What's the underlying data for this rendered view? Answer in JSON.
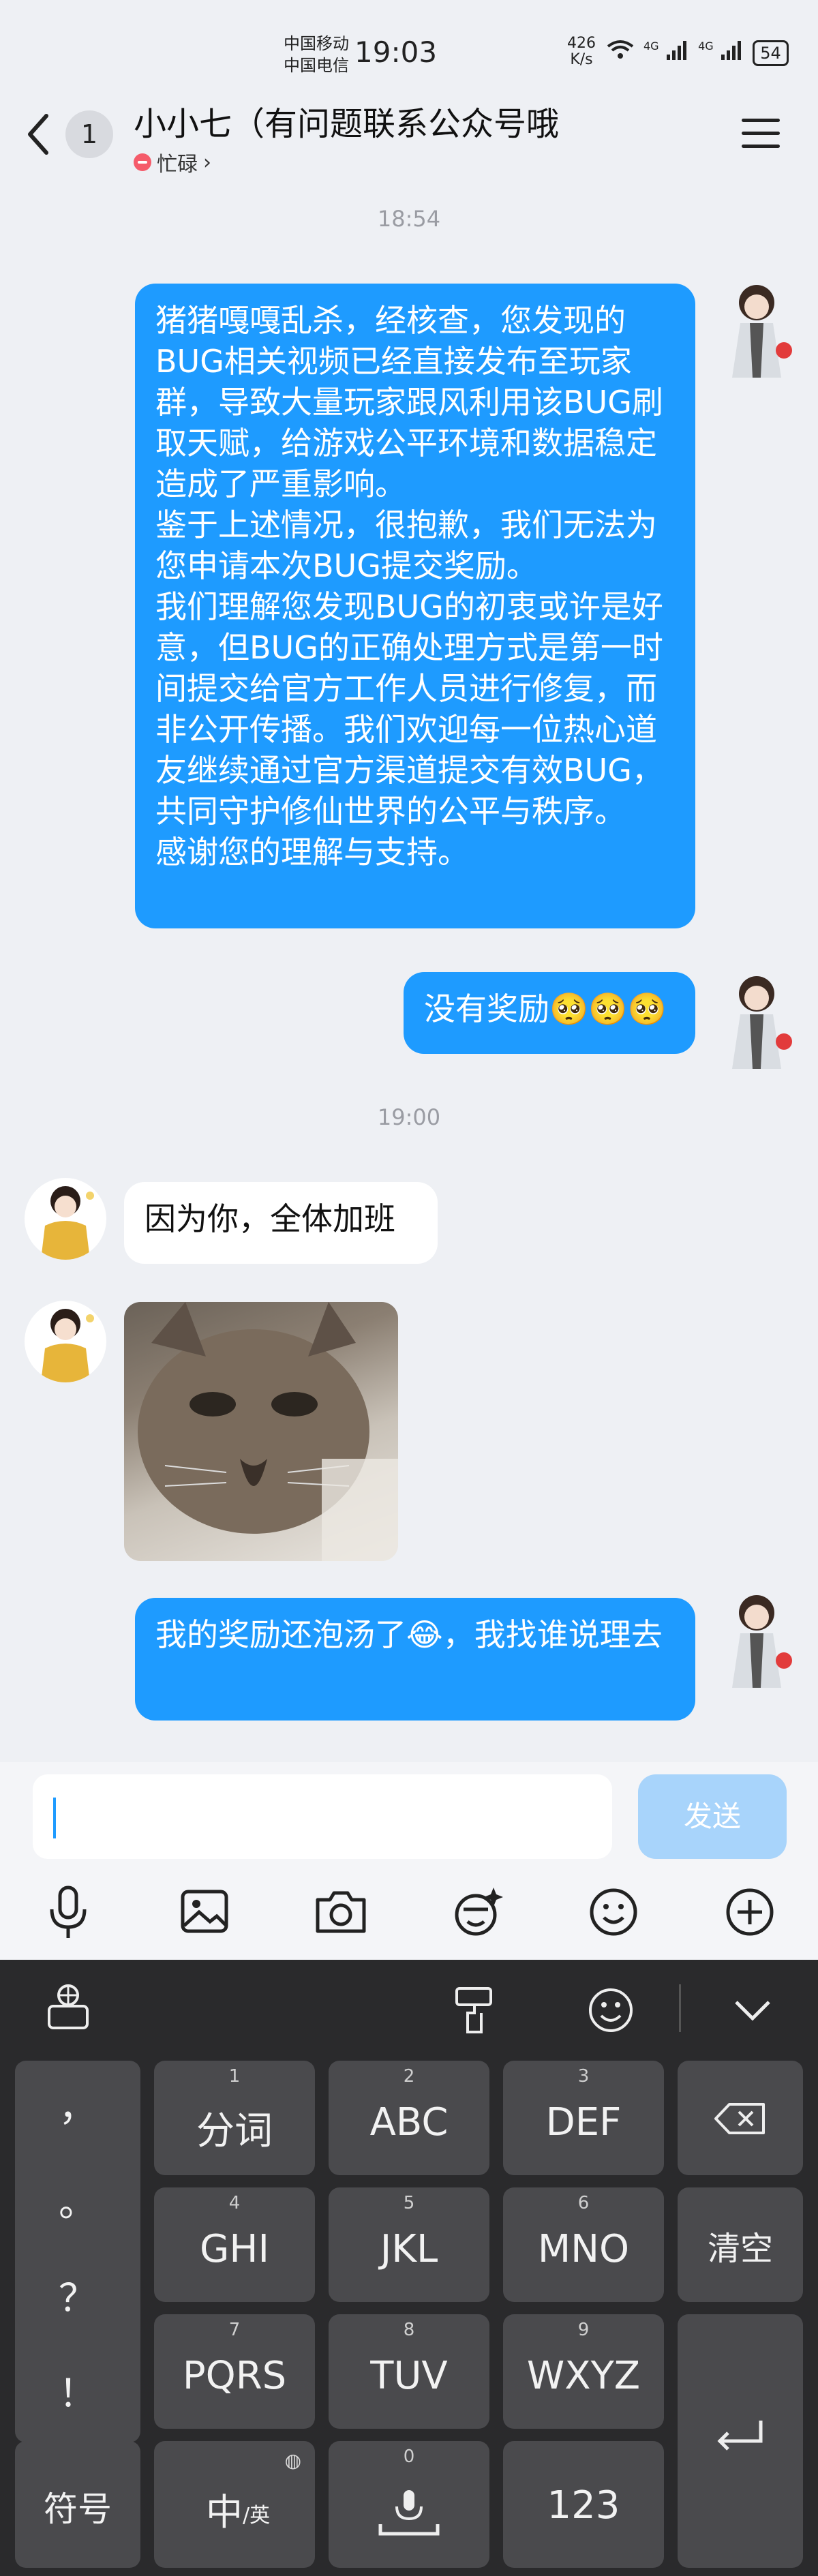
{
  "status_bar": {
    "carrier_1": "中国移动",
    "carrier_2": "中国电信",
    "time": "19:03",
    "speed_value": "426",
    "speed_unit": "K/s",
    "network_1": "4G",
    "network_2": "4G",
    "battery": "54"
  },
  "header": {
    "unread_count": "1",
    "title": "小小七（有问题联系公众号哦",
    "status": "忙碌"
  },
  "chat": {
    "timestamps": [
      "18:54",
      "19:00"
    ],
    "messages": [
      {
        "side": "me",
        "text": "猪猪嘎嘎乱杀，经核查，您发现的BUG相关视频已经直接发布至玩家群，导致大量玩家跟风利用该BUG刷取天赋，给游戏公平环境和数据稳定造成了严重影响。\n鉴于上述情况，很抱歉，我们无法为您申请本次BUG提交奖励。\n我们理解您发现BUG的初衷或许是好意，但BUG的正确处理方式是第一时间提交给官方工作人员进行修复，而非公开传播。我们欢迎每一位热心道友继续通过官方渠道提交有效BUG，共同守护修仙世界的公平与秩序。\n感谢您的理解与支持。"
      },
      {
        "side": "me",
        "text": "没有奖励🥺🥺🥺"
      },
      {
        "side": "other",
        "text": "因为你，全体加班"
      },
      {
        "side": "other",
        "image": "cat-photo"
      },
      {
        "side": "me",
        "text": "我的奖励还泡汤了😂，我找谁说理去"
      }
    ]
  },
  "input": {
    "placeholder": "",
    "send_label": "发送",
    "tools": [
      "microphone-icon",
      "image-icon",
      "camera-icon",
      "sticker-icon",
      "emoji-icon",
      "plus-icon"
    ]
  },
  "keyboard": {
    "side_keys": [
      "，",
      "。",
      "？",
      "！"
    ],
    "rows": [
      [
        {
          "num": "1",
          "label": "分词"
        },
        {
          "num": "2",
          "label": "ABC"
        },
        {
          "num": "3",
          "label": "DEF"
        }
      ],
      [
        {
          "num": "4",
          "label": "GHI"
        },
        {
          "num": "5",
          "label": "JKL"
        },
        {
          "num": "6",
          "label": "MNO"
        }
      ],
      [
        {
          "num": "7",
          "label": "PQRS"
        },
        {
          "num": "8",
          "label": "TUV"
        },
        {
          "num": "9",
          "label": "WXYZ"
        }
      ]
    ],
    "clear_label": "清空",
    "symbol_label": "符号",
    "chinese_label": "中",
    "english_sub": "/英",
    "space_num": "0",
    "numeric_label": "123"
  },
  "colors": {
    "my_bubble": "#1e9bff",
    "send_disabled": "#a8d4fb",
    "busy": "#f55b6a",
    "keyboard_bg": "#2a2a2c"
  }
}
